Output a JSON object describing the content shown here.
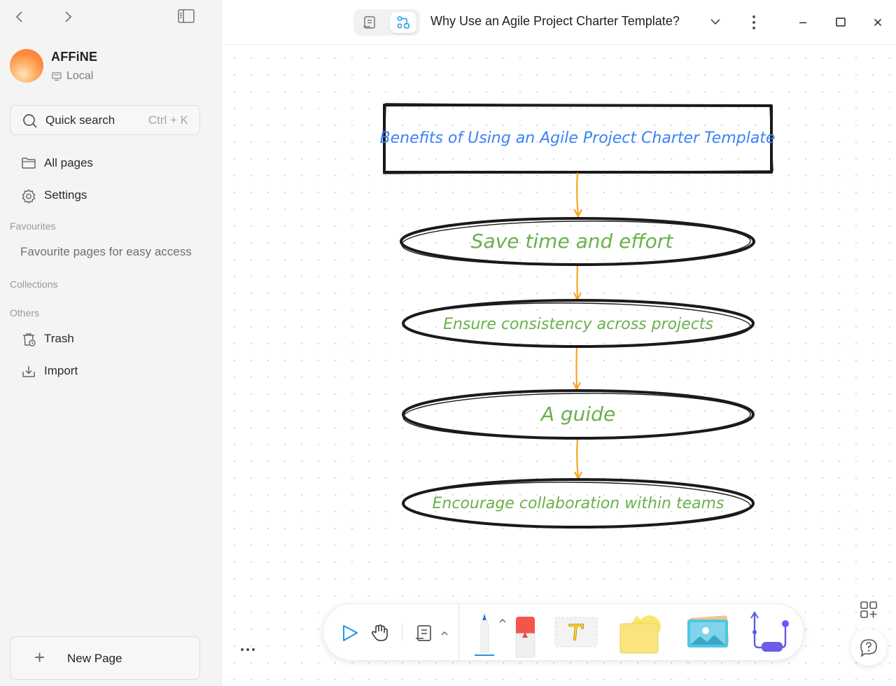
{
  "sidebar": {
    "workspace": {
      "name": "AFFiNE",
      "type": "Local"
    },
    "search": {
      "label": "Quick search",
      "shortcut": "Ctrl + K"
    },
    "items": [
      {
        "label": "All pages",
        "icon": "folder-icon"
      },
      {
        "label": "Settings",
        "icon": "gear-icon"
      }
    ],
    "favourites": {
      "label": "Favourites",
      "empty": "Favourite pages for easy access"
    },
    "collections": {
      "label": "Collections"
    },
    "others": {
      "label": "Others",
      "items": [
        {
          "label": "Trash",
          "icon": "trash-icon"
        },
        {
          "label": "Import",
          "icon": "import-icon"
        }
      ]
    },
    "new_page": "New Page"
  },
  "header": {
    "title": "Why Use an Agile Project Charter Template?",
    "modes": [
      "page-mode",
      "edgeless-mode"
    ],
    "active_mode": "edgeless-mode"
  },
  "diagram": {
    "title_box": "Benefits of Using an Agile Project Charter Template",
    "nodes": [
      "Save time and effort",
      "Ensure consistency across projects",
      "A guide",
      "Encourage collaboration within teams"
    ],
    "colors": {
      "title_text": "#3b82f6",
      "node_text": "#6ab04c",
      "arrow": "#f5a623",
      "stroke": "#1a1a1a"
    }
  },
  "toolbar": {
    "tools": [
      "select-icon",
      "hand-icon",
      "frame-icon",
      "pen-icon",
      "eraser-icon",
      "text-icon",
      "note-icon",
      "image-icon",
      "connector-icon"
    ]
  },
  "colors": {
    "accent": "#1e96eb",
    "sidebar_bg": "#f4f4f4"
  }
}
